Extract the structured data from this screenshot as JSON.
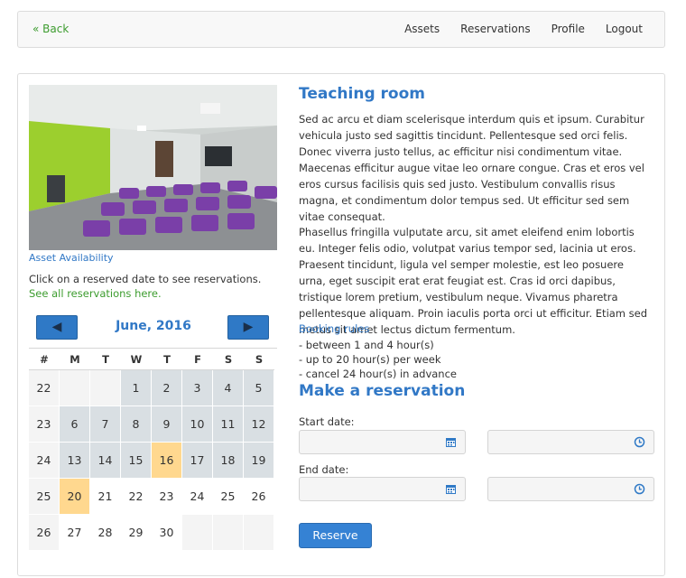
{
  "nav": {
    "back": "« Back",
    "links": [
      "Assets",
      "Reservations",
      "Profile",
      "Logout"
    ]
  },
  "asset": {
    "title": "Teaching room",
    "description_1": "Sed ac arcu et diam scelerisque interdum quis et ipsum. Curabitur vehicula justo sed sagittis tincidunt. Pellentesque sed orci felis. Donec viverra justo tellus, ac efficitur nisi condimentum vitae. Maecenas efficitur augue vitae leo ornare congue. Cras et eros vel eros cursus facilisis quis sed justo. Vestibulum convallis risus magna, et condimentum dolor tempus sed. Ut efficitur sed sem vitae consequat.",
    "description_2": "Phasellus fringilla vulputate arcu, sit amet eleifend enim lobortis eu. Integer felis odio, volutpat varius tempor sed, lacinia ut eros. Praesent tincidunt, ligula vel semper molestie, est leo posuere urna, eget suscipit erat erat feugiat est. Cras id orci dapibus, tristique lorem pretium, vestibulum neque. Vivamus pharetra pellentesque aliquam. Proin iaculis porta orci ut efficitur. Etiam sed metus sit amet lectus dictum fermentum.",
    "booking_rules_link": "Booking rules",
    "rules": [
      "- between 1 and 4 hour(s)",
      "- up to 20 hour(s) per week",
      "- cancel 24 hour(s) in advance"
    ]
  },
  "availability": {
    "link": "Asset Availability",
    "hint": "Click on a reserved date to see reservations.",
    "hint_link": "See all reservations here.",
    "month": "June, 2016",
    "prev_icon": "chevron-left-icon",
    "next_icon": "chevron-right-icon",
    "headers": [
      "#",
      "M",
      "T",
      "W",
      "T",
      "F",
      "S",
      "S"
    ],
    "weeks": [
      {
        "week": "22",
        "days": [
          {
            "d": "",
            "s": "empty"
          },
          {
            "d": "",
            "s": "empty"
          },
          {
            "d": "1",
            "s": "res"
          },
          {
            "d": "2",
            "s": "res"
          },
          {
            "d": "3",
            "s": "res"
          },
          {
            "d": "4",
            "s": "res"
          },
          {
            "d": "5",
            "s": "res"
          }
        ]
      },
      {
        "week": "23",
        "days": [
          {
            "d": "6",
            "s": "res"
          },
          {
            "d": "7",
            "s": "res"
          },
          {
            "d": "8",
            "s": "res"
          },
          {
            "d": "9",
            "s": "res"
          },
          {
            "d": "10",
            "s": "res"
          },
          {
            "d": "11",
            "s": "res"
          },
          {
            "d": "12",
            "s": "res"
          }
        ]
      },
      {
        "week": "24",
        "days": [
          {
            "d": "13",
            "s": "res"
          },
          {
            "d": "14",
            "s": "res"
          },
          {
            "d": "15",
            "s": "res"
          },
          {
            "d": "16",
            "s": "sel"
          },
          {
            "d": "17",
            "s": "res"
          },
          {
            "d": "18",
            "s": "res"
          },
          {
            "d": "19",
            "s": "res"
          }
        ]
      },
      {
        "week": "25",
        "days": [
          {
            "d": "20",
            "s": "sel"
          },
          {
            "d": "21",
            "s": "plain"
          },
          {
            "d": "22",
            "s": "plain"
          },
          {
            "d": "23",
            "s": "plain"
          },
          {
            "d": "24",
            "s": "plain"
          },
          {
            "d": "25",
            "s": "plain"
          },
          {
            "d": "26",
            "s": "plain"
          }
        ]
      },
      {
        "week": "26",
        "days": [
          {
            "d": "27",
            "s": "plain"
          },
          {
            "d": "28",
            "s": "plain"
          },
          {
            "d": "29",
            "s": "plain"
          },
          {
            "d": "30",
            "s": "plain"
          },
          {
            "d": "",
            "s": "empty"
          },
          {
            "d": "",
            "s": "empty"
          },
          {
            "d": "",
            "s": "empty"
          }
        ]
      }
    ]
  },
  "reservation": {
    "title": "Make a reservation",
    "start_label": "Start date:",
    "end_label": "End date:",
    "date_icon": "calendar-icon",
    "time_icon": "clock-icon",
    "submit": "Reserve"
  },
  "colors": {
    "accent": "#3178c6",
    "link_green": "#3c9c2e",
    "reserved_day": "#d9dfe3",
    "selected_day": "#ffd88f"
  }
}
